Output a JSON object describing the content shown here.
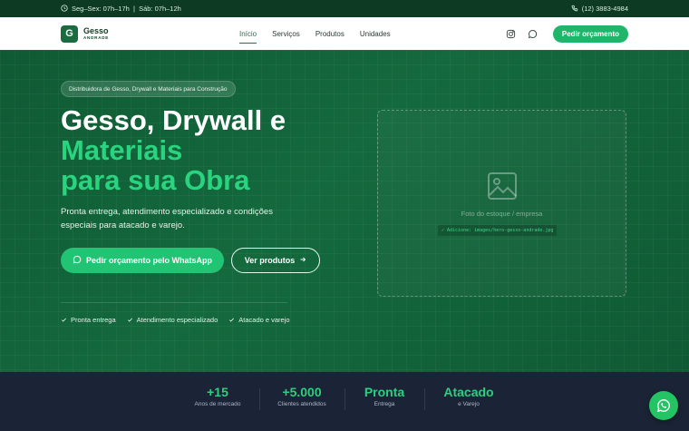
{
  "topbar": {
    "hours": "Seg–Sex: 07h–17h  |  Sáb: 07h–12h",
    "phone": "(12) 3883-4984"
  },
  "brand": {
    "mark": "G",
    "name": "Gesso",
    "subname": "ANDRADE"
  },
  "nav": {
    "items": [
      {
        "label": "Início",
        "active": true
      },
      {
        "label": "Serviços",
        "active": false
      },
      {
        "label": "Produtos",
        "active": false
      },
      {
        "label": "Unidades",
        "active": false
      }
    ],
    "cta": "Pedir orçamento"
  },
  "hero": {
    "badge": "Distribuidora de Gesso, Drywall e Materiais para Construção",
    "title_line1": "Gesso, Drywall e",
    "title_accent1": "Materiais",
    "title_accent2": "para sua Obra",
    "lead": "Pronta entrega, atendimento especializado e condições especiais para atacado e varejo.",
    "btn_whatsapp": "Pedir orçamento pelo WhatsApp",
    "btn_products": "Ver produtos",
    "checks": [
      "Pronta entrega",
      "Atendimento especializado",
      "Atacado e varejo"
    ],
    "photo_caption": "Foto do estoque / empresa",
    "photo_path": "✓ Adicione: images/hero-gesso-andrade.jpg"
  },
  "stats": [
    {
      "value": "+15",
      "label": "Anos de mercado"
    },
    {
      "value": "+5.000",
      "label": "Clientes atendidos"
    },
    {
      "value": "Pronta",
      "label": "Entrega"
    },
    {
      "value": "Atacado",
      "label": "e Varejo"
    }
  ],
  "colors": {
    "brand_dark": "#0c3a22",
    "accent": "#22c473",
    "stats_bg": "#1b2436"
  },
  "icons": [
    "clock-icon",
    "phone-icon",
    "instagram-icon",
    "chat-icon",
    "whatsapp-icon",
    "arrow-right-icon",
    "check-icon",
    "image-icon"
  ]
}
